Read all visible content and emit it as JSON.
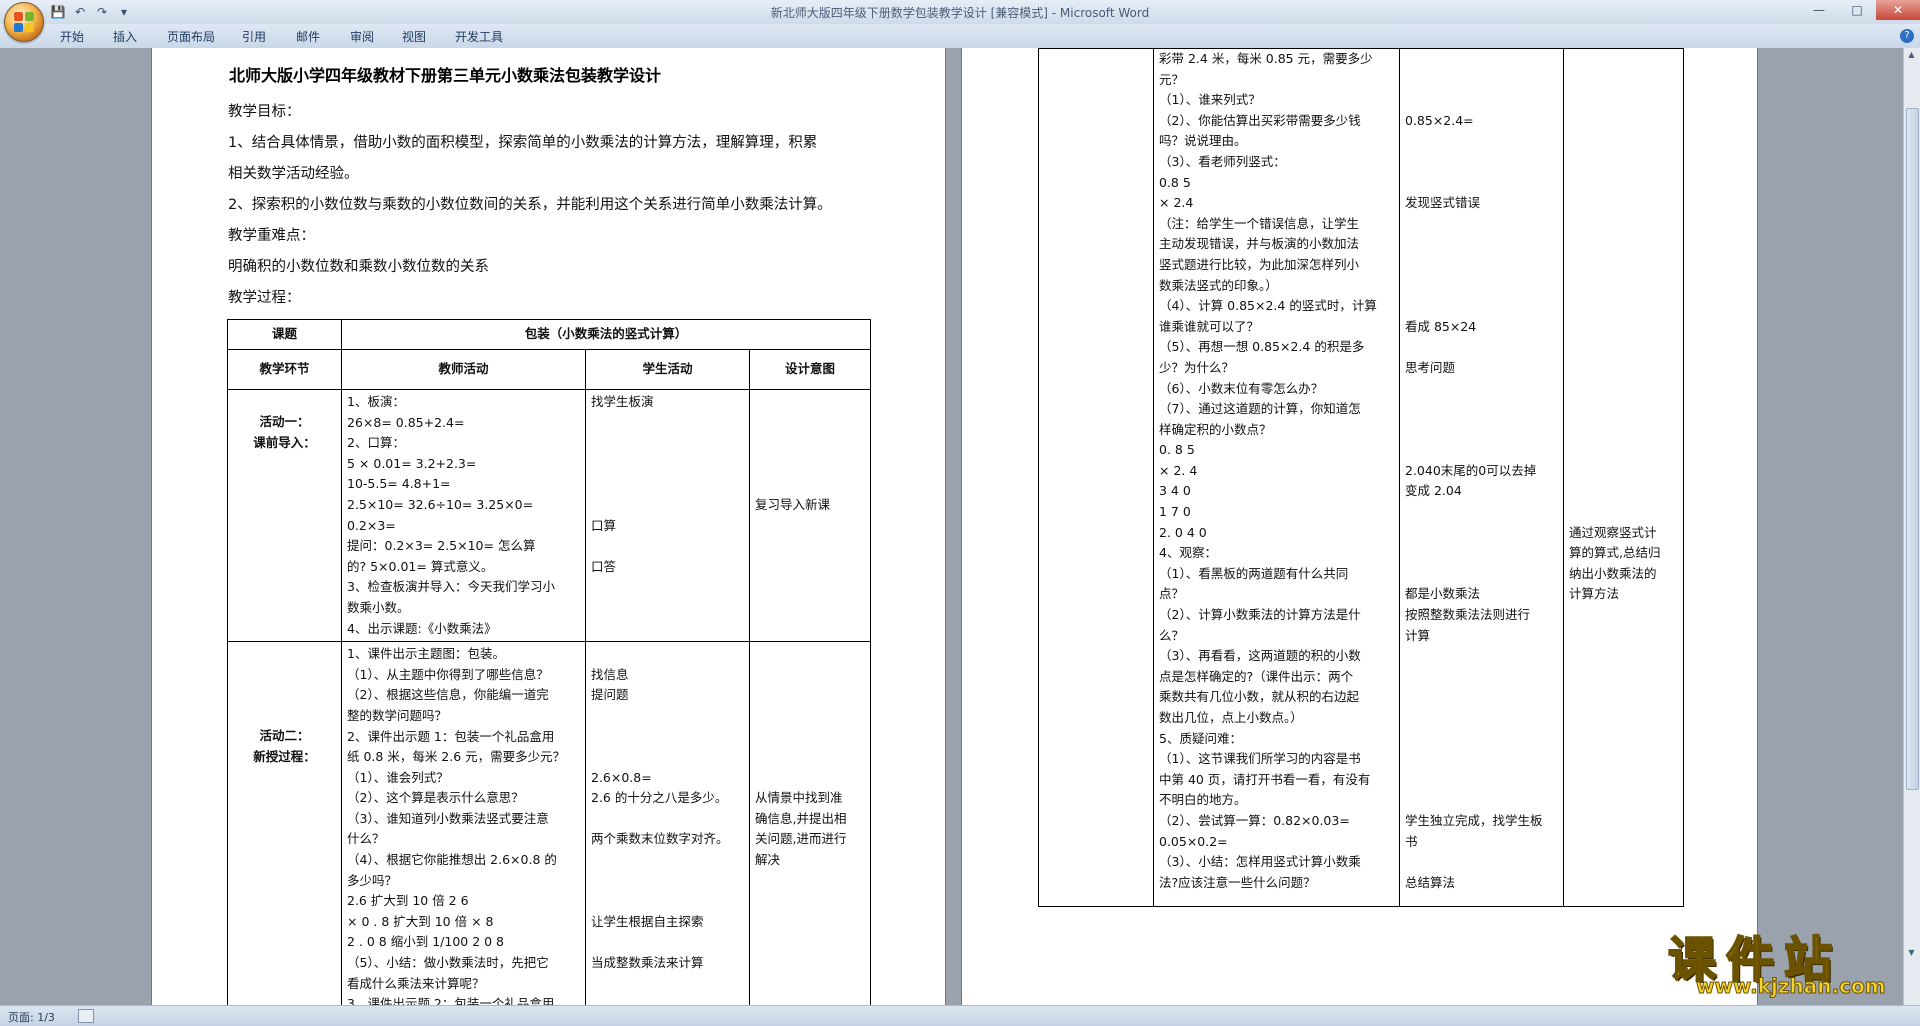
{
  "window": {
    "title": "新北师大版四年级下册数学包装教学设计 [兼容模式] - Microsoft Word",
    "controls": [
      "minimize",
      "maximize",
      "close"
    ]
  },
  "ribbon": {
    "tabs": [
      "开始",
      "插入",
      "页面布局",
      "引用",
      "邮件",
      "审阅",
      "视图",
      "开发工具"
    ]
  },
  "document": {
    "title": "北师大版小学四年级教材下册第三单元小数乘法包装教学设计",
    "paragraphs": [
      "教学目标：",
      "1、结合具体情景，借助小数的面积模型，探索简单的小数乘法的计算方法，理解算理，积累",
      "相关数学活动经验。",
      "2、探索积的小数位数与乘数的小数位数间的关系，并能利用这个关系进行简单小数乘法计算。",
      "教学重难点：",
      "明确积的小数位数和乘数小数位数的关系",
      "教学过程："
    ],
    "table": {
      "topic_label": "课题",
      "topic_value": "包装（小数乘法的竖式计算）",
      "headers": [
        "教学环节",
        "教师活动",
        "学生活动",
        "设计意图"
      ],
      "stage1": {
        "name": [
          "活动一：",
          "课前导入："
        ],
        "teacher": [
          "1、板演：",
          "26×8=              0.85+2.4=",
          "2、口算：",
          "   5 × 0.01=                   3.2+2.3=",
          "10-5.5=                      4.8+1=",
          "  2.5×10=  32.6÷10=              3.25×0=",
          "0.2×3=",
          "提问：0.2×3=    2.5×10=    怎么算",
          "的?     5×0.01= 算式意义。",
          "3、检查板演并导入：今天我们学习小",
          "数乘小数。",
          "4、出示课题:《小数乘法》"
        ],
        "student": [
          "找学生板演",
          "",
          "",
          "",
          "",
          "",
          "口算",
          "",
          "口答"
        ],
        "intent": [
          "",
          "",
          "",
          "",
          "",
          "复习导入新课"
        ]
      },
      "stage2": {
        "name": [
          "活动二：",
          "新授过程："
        ],
        "teacher": [
          "1、课件出示主题图：包装。",
          "（1）、从主题中你得到了哪些信息？",
          "（2）、根据这些信息，你能编一道完",
          "整的数学问题吗？",
          "2、课件出示题 1：包装一个礼品盒用",
          "纸 0.8 米，每米 2.6 元，需要多少元？",
          "（1）、谁会列式？",
          "（2）、这个算是表示什么意思？",
          "（3）、谁知道列小数乘法竖式要注意",
          "什么？",
          "（4）、根据它你能推想出 2.6×0.8 的",
          "多少吗？",
          "     2.6      扩大到 10 倍        2  6",
          "  ×  0 . 8   扩大到 10 倍      ×    8",
          "  2 . 0    8   缩小到 1/100      2  0  8",
          "（5）、小结：做小数乘法时，先把它",
          "看成什么乘法来计算呢？",
          "3、课件出示题 2：包装一个礼品盒用"
        ],
        "student": [
          "",
          "找信息",
          "提问题",
          "",
          "",
          "",
          "2.6×0.8=",
          "2.6 的十分之八是多少。",
          "",
          "两个乘数末位数字对齐。",
          "",
          "",
          "",
          "让学生根据自主探索",
          "",
          "当成整数乘法来计算"
        ],
        "intent": [
          "",
          "",
          "",
          "",
          "",
          "",
          "",
          "从情景中找到准",
          "确信息,并提出相",
          "关问题,进而进行",
          "解决"
        ]
      }
    },
    "right_page": {
      "teacher": [
        "彩带 2.4 米，每米 0.85 元，需要多少",
        "元？",
        "（1）、谁来列式？",
        "（2）、你能估算出买彩带需要多少钱",
        "吗？说说理由。",
        "（3）、看老师列竖式：",
        "              0.8 5",
        "          ×  2.4",
        "（注：给学生一个错误信息，让学生",
        "主动发现错误，并与板演的小数加法",
        "竖式题进行比较，为此加深怎样列小",
        "数乘法竖式的印象。）",
        "（4）、计算 0.85×2.4 的竖式时，计算",
        "谁乘谁就可以了？",
        "（5）、再想一想  0.85×2.4 的积是多",
        "少？为什么？",
        "（6）、小数末位有零怎么办？",
        "（7）、通过这道题的计算，你知道怎",
        "样确定积的小数点？",
        "          0. 8  5",
        "      ×     2. 4",
        "          3  4  0",
        "       1  7  0",
        "       2. 0  4  0",
        "4、观察：",
        "（1）、看黑板的两道题有什么共同",
        "点？",
        "（2）、计算小数乘法的计算方法是什",
        "么？",
        "（3）、再看看，这两道题的积的小数",
        "点是怎样确定的?（课件出示：两个",
        "乘数共有几位小数，就从积的右边起",
        "数出几位，点上小数点。）",
        "5、质疑问难：",
        "（1）、这节课我们所学习的内容是书",
        "中第 40 页，请打开书看一看，有没有",
        "不明白的地方。",
        "（2）、尝试算一算：0.82×0.03=",
        "      0.05×0.2=",
        "（3）、小结：怎样用竖式计算小数乘",
        "法?应该注意一些什么问题？"
      ],
      "student": [
        "",
        "",
        "",
        "0.85×2.4=",
        "",
        "",
        "",
        "发现竖式错误",
        "",
        "",
        "",
        "",
        "",
        "看成 85×24",
        "",
        "思考问题",
        "",
        "",
        "",
        "",
        "2.040末尾的0可以去掉",
        "变成 2.04",
        "",
        "",
        "",
        "",
        "都是小数乘法",
        "按照整数乘法法则进行",
        "计算",
        "",
        "",
        "",
        "",
        "",
        "",
        "",
        "",
        "学生独立完成，找学生板",
        "书",
        "",
        "总结算法"
      ],
      "intent": [
        "",
        "",
        "",
        "",
        "",
        "",
        "",
        "",
        "",
        "",
        "",
        "",
        "",
        "",
        "",
        "",
        "",
        "",
        "",
        "",
        "",
        "",
        "",
        "通过观察竖式计",
        "算的算式,总结归",
        "纳出小数乘法的",
        "计算方法"
      ]
    }
  },
  "status": {
    "page": "页面: 1/3"
  },
  "watermark": {
    "text": "课件站",
    "url": "www.kjzhan.com"
  }
}
